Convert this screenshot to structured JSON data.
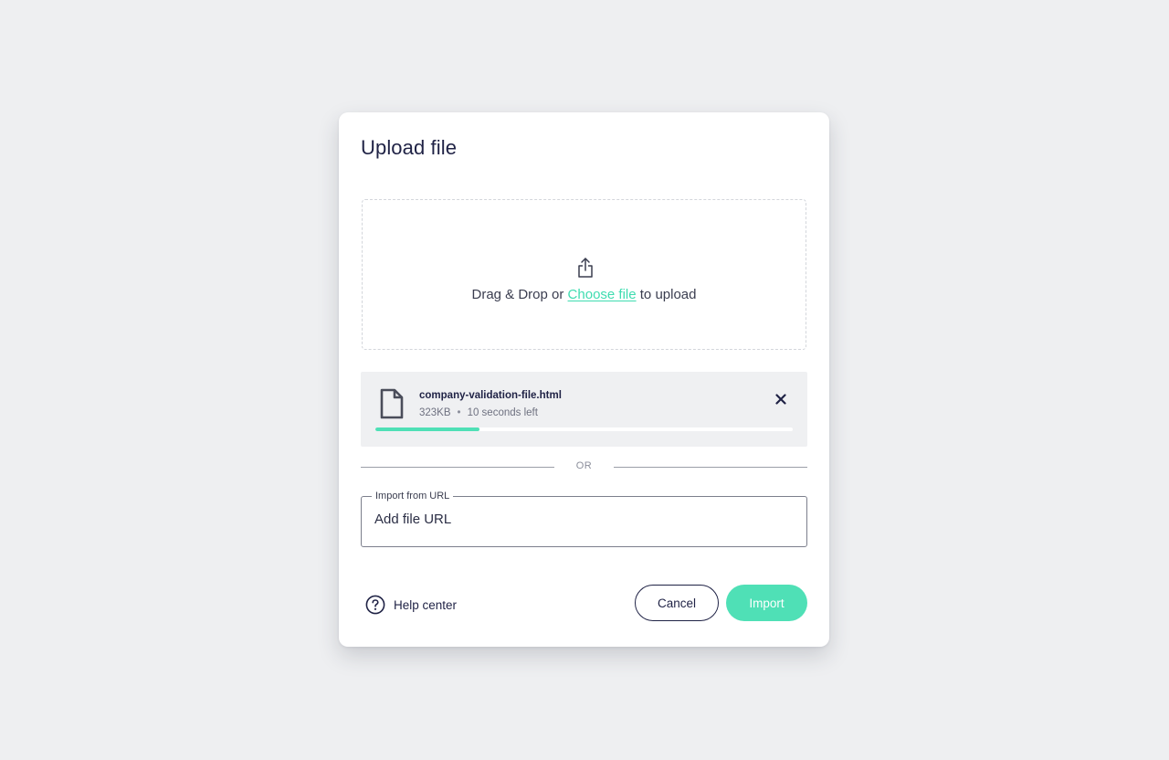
{
  "modal": {
    "title": "Upload file"
  },
  "dropzone": {
    "icon": "upload-share-icon",
    "text_before": "Drag & Drop or ",
    "link_label": "Choose file",
    "text_after": " to upload"
  },
  "upload": {
    "file_icon": "document-icon",
    "file_name": "company-validation-file.html",
    "file_size": "323KB",
    "separator": "•",
    "time_left": "10 seconds left",
    "progress_percent": 25,
    "close_icon": "close-icon"
  },
  "divider": {
    "label": "OR"
  },
  "url_import": {
    "label": "Import from URL",
    "value": "",
    "placeholder": "Add file URL"
  },
  "footer": {
    "help_icon": "question-circle-icon",
    "help_label": "Help center",
    "cancel_label": "Cancel",
    "import_label": "Import"
  },
  "colors": {
    "accent": "#4fe0b6",
    "link": "#3fdcb0",
    "text_primary": "#1f2245",
    "background": "#eeeff1"
  }
}
